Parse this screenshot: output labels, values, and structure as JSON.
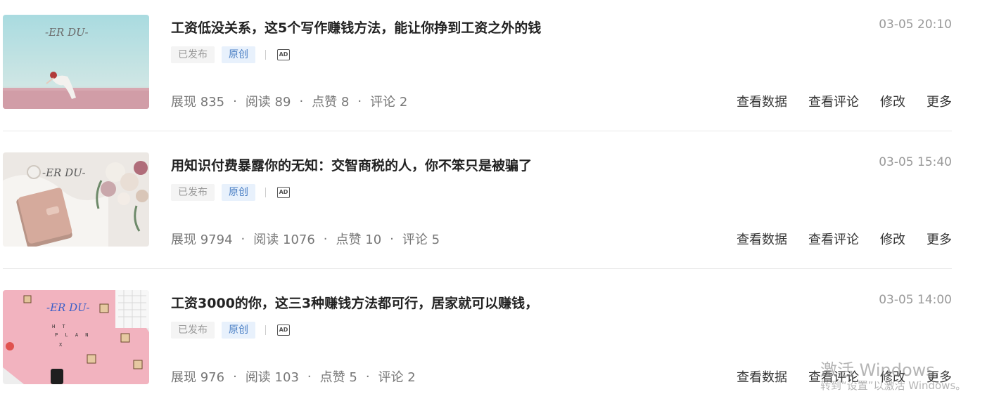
{
  "articles": [
    {
      "title": "工资低没关系，这5个写作赚钱方法，能让你挣到工资之外的钱",
      "time": "03-05 20:10",
      "status": "已发布",
      "tag": "原创",
      "ad": "AD",
      "thumb_text": "-ER DU-",
      "stats": {
        "exposure": "展现 835",
        "reads": "阅读 89",
        "likes": "点赞 8",
        "comments": "评论 2"
      },
      "actions": {
        "data": "查看数据",
        "comments": "查看评论",
        "edit": "修改",
        "more": "更多"
      }
    },
    {
      "title": "用知识付费暴露你的无知：交智商税的人，你不笨只是被骗了",
      "time": "03-05 15:40",
      "status": "已发布",
      "tag": "原创",
      "ad": "AD",
      "thumb_text": "-ER DU-",
      "stats": {
        "exposure": "展现 9794",
        "reads": "阅读 1076",
        "likes": "点赞 10",
        "comments": "评论 5"
      },
      "actions": {
        "data": "查看数据",
        "comments": "查看评论",
        "edit": "修改",
        "more": "更多"
      }
    },
    {
      "title": "工资3000的你，这三3种赚钱方法都可行，居家就可以赚钱，",
      "time": "03-05 14:00",
      "status": "已发布",
      "tag": "原创",
      "ad": "AD",
      "thumb_text": "-ER DU-",
      "stats": {
        "exposure": "展现 976",
        "reads": "阅读 103",
        "likes": "点赞 5",
        "comments": "评论 2"
      },
      "actions": {
        "data": "查看数据",
        "comments": "查看评论",
        "edit": "修改",
        "more": "更多"
      }
    }
  ],
  "watermark": {
    "line1": "激活 Windows",
    "line2": "转到“设置”以激活 Windows。"
  },
  "colors": {
    "title": "#222222",
    "meta": "#999999",
    "original_tag_bg": "#e8f1fc",
    "original_tag_text": "#4a7fc4"
  }
}
